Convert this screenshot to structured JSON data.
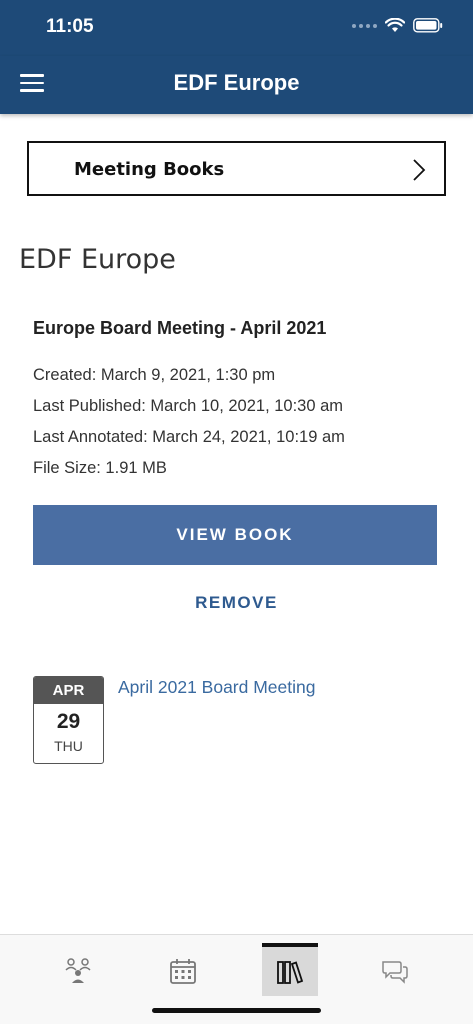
{
  "status_bar": {
    "time": "11:05"
  },
  "header": {
    "title": "EDF Europe",
    "menu_icon": "hamburger-icon"
  },
  "meeting_books": {
    "label": "Meeting Books",
    "icon": "chevron-right-icon"
  },
  "section": {
    "title": "EDF Europe"
  },
  "book": {
    "title": "Europe Board Meeting - April 2021",
    "created": "Created: March 9, 2021, 1:30 pm",
    "published": "Last Published: March 10, 2021, 10:30 am",
    "annotated": "Last Annotated: March 24, 2021, 10:19 am",
    "file_size": "File Size: 1.91 MB",
    "view_label": "VIEW BOOK",
    "remove_label": "REMOVE"
  },
  "event": {
    "month": "APR",
    "day": "29",
    "weekday": "THU",
    "title": "April 2021 Board Meeting"
  },
  "tabs": [
    {
      "name": "people",
      "icon": "people-icon",
      "active": false
    },
    {
      "name": "calendar",
      "icon": "calendar-icon",
      "active": false
    },
    {
      "name": "books",
      "icon": "books-icon",
      "active": true
    },
    {
      "name": "messages",
      "icon": "chat-icon",
      "active": false
    }
  ],
  "colors": {
    "header_bg": "#1e4a78",
    "button_bg": "#4a6ea3",
    "link": "#3a6aa0",
    "badge_month_bg": "#555555"
  }
}
